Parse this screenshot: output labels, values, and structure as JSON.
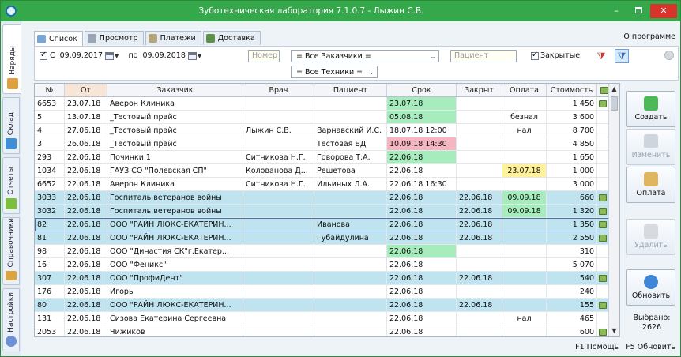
{
  "window": {
    "title": "Зуботехническая лаборатория 7.1.0.7 - Лыжин С.В.",
    "min_label": "–",
    "close_label": "✕"
  },
  "left_tabs": [
    {
      "label": "Наряды",
      "icon": "orders-icon",
      "color": "#e0a040"
    },
    {
      "label": "Склад",
      "icon": "warehouse-icon",
      "color": "#3f8fd8"
    },
    {
      "label": "Отчеты",
      "icon": "reports-icon",
      "color": "#7cbf3a"
    },
    {
      "label": "Справочники",
      "icon": "books-icon",
      "color": "#d9a441"
    },
    {
      "label": "Настройки",
      "icon": "settings-icon",
      "color": "#6d8fd6"
    }
  ],
  "top_tabs": [
    {
      "label": "Список",
      "icon": "list-icon"
    },
    {
      "label": "Просмотр",
      "icon": "view-icon"
    },
    {
      "label": "Платежи",
      "icon": "payments-icon"
    },
    {
      "label": "Доставка",
      "icon": "delivery-icon"
    }
  ],
  "about_label": "О программе",
  "filter": {
    "from_label": "С",
    "from_date": "09.09.2017",
    "to_label": "по",
    "to_date": "09.09.2018",
    "number_placeholder": "Номер",
    "customers_value": "= Все Заказчики =",
    "patient_placeholder": "Пациент",
    "closed_label": "Закрытые",
    "technicians_value": "= Все Техники ="
  },
  "table": {
    "columns": [
      "№",
      "От",
      "Заказчик",
      "Врач",
      "Пациент",
      "Срок",
      "Закрыт",
      "Оплата",
      "Стоимость"
    ],
    "rows": [
      {
        "num": "6653",
        "from": "23.07.18",
        "customer": "Аверон Клиника",
        "doctor": "",
        "patient": "",
        "due": "23.07.18",
        "closed": "",
        "payment": "",
        "cost": "1 450",
        "icon": true,
        "due_color": "g",
        "sel": false
      },
      {
        "num": "5",
        "from": "13.07.18",
        "customer": "_Тестовый прайс",
        "doctor": "",
        "patient": "",
        "due": "05.08.18",
        "closed": "",
        "payment": "безнал",
        "cost": "3 600",
        "icon": false,
        "due_color": "g",
        "sel": false
      },
      {
        "num": "4",
        "from": "27.06.18",
        "customer": "_Тестовый прайс",
        "doctor": "Лыжин С.В.",
        "patient": "Варнавский И.С.",
        "due": "18.07.18 12:00",
        "closed": "",
        "payment": "нал",
        "cost": "8 700",
        "icon": false,
        "due_color": "",
        "sel": false
      },
      {
        "num": "3",
        "from": "26.06.18",
        "customer": "_Тестовый прайс",
        "doctor": "",
        "patient": "Тестовая БД",
        "due": "10.09.18 14:30",
        "closed": "",
        "payment": "",
        "cost": "4 850",
        "icon": false,
        "due_color": "r",
        "sel": false
      },
      {
        "num": "293",
        "from": "22.06.18",
        "customer": "Починки 1",
        "doctor": "Ситникова Н.Г.",
        "patient": "Говорова Т.А.",
        "due": "22.06.18",
        "closed": "",
        "payment": "",
        "cost": "1 650",
        "icon": false,
        "due_color": "g",
        "sel": false
      },
      {
        "num": "1034",
        "from": "22.06.18",
        "customer": "ГАУЗ СО \"Полевская СП\"",
        "doctor": "Колованова Д...",
        "patient": "Решетова",
        "due": "22.06.18",
        "closed": "",
        "payment": "23.07.18",
        "cost": "1 000",
        "icon": false,
        "due_color": "",
        "pay_color": "y",
        "sel": false
      },
      {
        "num": "6652",
        "from": "22.06.18",
        "customer": "Аверон Клиника",
        "doctor": "Ситникова Н.Г.",
        "patient": "Ильиных Л.А.",
        "due": "22.06.18 16:30",
        "closed": "",
        "payment": "",
        "cost": "3 000",
        "icon": false,
        "due_color": "",
        "sel": false
      },
      {
        "num": "3033",
        "from": "22.06.18",
        "customer": "Госпиталь ветеранов войны",
        "doctor": "",
        "patient": "",
        "due": "22.06.18",
        "closed": "22.06.18",
        "payment": "09.09.18",
        "cost": "660",
        "icon": true,
        "due_color": "",
        "pay_color": "g",
        "sel": true
      },
      {
        "num": "3032",
        "from": "22.06.18",
        "customer": "Госпиталь ветеранов войны",
        "doctor": "",
        "patient": "",
        "due": "22.06.18",
        "closed": "22.06.18",
        "payment": "09.09.18",
        "cost": "1 320",
        "icon": true,
        "due_color": "",
        "pay_color": "g",
        "sel": true
      },
      {
        "num": "82",
        "from": "22.06.18",
        "customer": "ООО \"РАЙН ЛЮКС-ЕКАТЕРИН...",
        "doctor": "",
        "patient": "Иванова",
        "due": "22.06.18",
        "closed": "22.06.18",
        "payment": "",
        "cost": "1 350",
        "icon": true,
        "due_color": "",
        "sel": true,
        "box": true
      },
      {
        "num": "81",
        "from": "22.06.18",
        "customer": "ООО \"РАЙН ЛЮКС-ЕКАТЕРИН...",
        "doctor": "",
        "patient": "Губайдулина",
        "due": "22.06.18",
        "closed": "22.06.18",
        "payment": "",
        "cost": "2 550",
        "icon": true,
        "due_color": "",
        "sel": true
      },
      {
        "num": "98",
        "from": "22.06.18",
        "customer": "ООО \"Династия СК\"г.Екатер...",
        "doctor": "",
        "patient": "",
        "due": "22.06.18",
        "closed": "",
        "payment": "",
        "cost": "310",
        "icon": false,
        "due_color": "g",
        "sel": false
      },
      {
        "num": "16",
        "from": "22.06.18",
        "customer": "ООО \"Феникс\"",
        "doctor": "",
        "patient": "",
        "due": "22.06.18",
        "closed": "",
        "payment": "",
        "cost": "5 070",
        "icon": false,
        "due_color": "",
        "sel": false
      },
      {
        "num": "307",
        "from": "22.06.18",
        "customer": "ООО \"ПрофиДент\"",
        "doctor": "",
        "patient": "",
        "due": "22.06.18",
        "closed": "22.06.18",
        "payment": "",
        "cost": "540",
        "icon": true,
        "due_color": "",
        "sel": true
      },
      {
        "num": "176",
        "from": "22.06.18",
        "customer": "Игорь",
        "doctor": "",
        "patient": "",
        "due": "22.06.18",
        "closed": "",
        "payment": "",
        "cost": "240",
        "icon": false,
        "due_color": "",
        "sel": false
      },
      {
        "num": "80",
        "from": "22.06.18",
        "customer": "ООО \"РАЙН ЛЮКС-ЕКАТЕРИН...",
        "doctor": "",
        "patient": "",
        "due": "22.06.18",
        "closed": "22.06.18",
        "payment": "",
        "cost": "155",
        "icon": true,
        "due_color": "",
        "sel": true
      },
      {
        "num": "131",
        "from": "22.06.18",
        "customer": "Сизова Екатерина Сергеевна",
        "doctor": "",
        "patient": "",
        "due": "22.06.18",
        "closed": "",
        "payment": "нал",
        "cost": "465",
        "icon": false,
        "due_color": "",
        "sel": false
      },
      {
        "num": "2053",
        "from": "22.06.18",
        "customer": "Чижиков",
        "doctor": "",
        "patient": "",
        "due": "22.06.18",
        "closed": "",
        "payment": "",
        "cost": "600",
        "icon": true,
        "due_color": "",
        "sel": false
      }
    ]
  },
  "actions": {
    "create": "Создать",
    "edit": "Изменить",
    "payment": "Оплата",
    "delete": "Удалить",
    "refresh": "Обновить",
    "selected_label": "Выбрано:",
    "selected_count": "2626"
  },
  "status": {
    "help": "F1 Помощь",
    "refresh": "F5 Обновить"
  },
  "colors": {
    "titlebar": "#34a84a",
    "selected_row": "#bfe3ef",
    "due_green": "#a6ecbc",
    "due_red": "#f6b6c1",
    "payment_yellow": "#fff29a"
  }
}
